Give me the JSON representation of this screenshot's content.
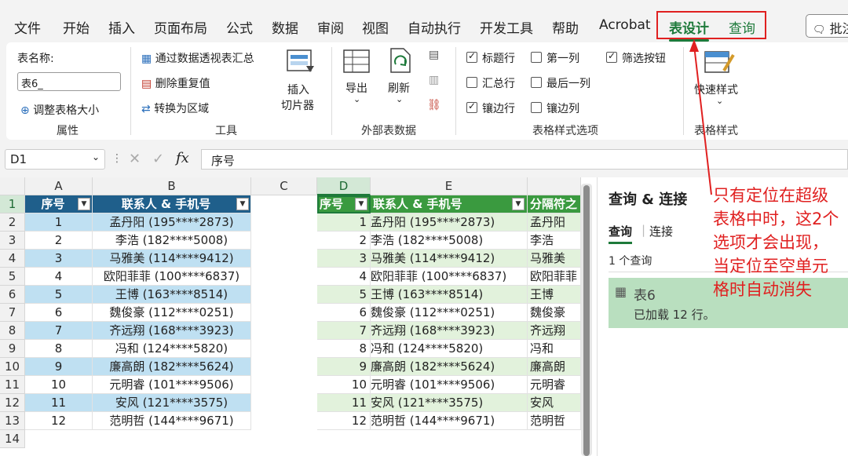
{
  "tabs": [
    "文件",
    "开始",
    "插入",
    "页面布局",
    "公式",
    "数据",
    "审阅",
    "视图",
    "自动执行",
    "开发工具",
    "帮助",
    "Acrobat"
  ],
  "tab_design": "表设计",
  "tab_query": "查询",
  "comment_button": "批注",
  "ribbon": {
    "table_name_label": "表名称:",
    "table_name_value": "表6_",
    "resize_table": "调整表格大小",
    "group_properties": "属性",
    "pivot_summary": "通过数据透视表汇总",
    "remove_duplicates": "删除重复值",
    "convert_to_range": "转换为区域",
    "insert_slicer_1": "插入",
    "insert_slicer_2": "切片器",
    "group_tools": "工具",
    "export": "导出",
    "refresh": "刷新",
    "group_external": "外部表数据",
    "opt_header_row": "标题行",
    "opt_total_row": "汇总行",
    "opt_banded_rows": "镶边行",
    "opt_first_column": "第一列",
    "opt_last_column": "最后一列",
    "opt_banded_columns": "镶边列",
    "opt_filter_button": "筛选按钮",
    "group_style_options": "表格样式选项",
    "quick_styles": "快速样式",
    "group_table_styles": "表格样式"
  },
  "formula_bar": {
    "name_box": "D1",
    "fx": "fx",
    "content": "序号"
  },
  "columns": [
    "A",
    "B",
    "C",
    "D",
    "E"
  ],
  "rows": [
    "1",
    "2",
    "3",
    "4",
    "5",
    "6",
    "7",
    "8",
    "9",
    "10",
    "11",
    "12",
    "13",
    "14"
  ],
  "table_left": {
    "headers": [
      "序号",
      "联系人 & 手机号"
    ],
    "rows": [
      [
        "1",
        "孟丹阳 (195****2873)"
      ],
      [
        "2",
        "李浩 (182****5008)"
      ],
      [
        "3",
        "马雅美 (114****9412)"
      ],
      [
        "4",
        "欧阳菲菲 (100****6837)"
      ],
      [
        "5",
        "王博 (163****8514)"
      ],
      [
        "6",
        "魏俊豪 (112****0251)"
      ],
      [
        "7",
        "齐远翔 (168****3923)"
      ],
      [
        "8",
        "冯和 (124****5820)"
      ],
      [
        "9",
        "廉高朗 (182****5624)"
      ],
      [
        "10",
        "元明睿 (101****9506)"
      ],
      [
        "11",
        "安风 (121****3575)"
      ],
      [
        "12",
        "范明哲 (144****9671)"
      ]
    ]
  },
  "table_right": {
    "headers": [
      "序号",
      "联系人 & 手机号",
      "分隔符之"
    ],
    "rows": [
      [
        "1",
        "孟丹阳 (195****2873)",
        "孟丹阳"
      ],
      [
        "2",
        "李浩 (182****5008)",
        "李浩"
      ],
      [
        "3",
        "马雅美 (114****9412)",
        "马雅美"
      ],
      [
        "4",
        "欧阳菲菲 (100****6837)",
        "欧阳菲菲"
      ],
      [
        "5",
        "王博 (163****8514)",
        "王博"
      ],
      [
        "6",
        "魏俊豪 (112****0251)",
        "魏俊豪"
      ],
      [
        "7",
        "齐远翔 (168****3923)",
        "齐远翔"
      ],
      [
        "8",
        "冯和 (124****5820)",
        "冯和"
      ],
      [
        "9",
        "廉高朗 (182****5624)",
        "廉高朗"
      ],
      [
        "10",
        "元明睿 (101****9506)",
        "元明睿"
      ],
      [
        "11",
        "安风 (121****3575)",
        "安风"
      ],
      [
        "12",
        "范明哲 (144****9671)",
        "范明哲"
      ]
    ]
  },
  "query_pane": {
    "title": "查询 & 连接",
    "tab_queries": "查询",
    "tab_connections": "连接",
    "count": "1 个查询",
    "query_name": "表6",
    "query_status": "已加载 12 行。"
  },
  "annotation": "只有定位在超级表格中时，这2个选项才会出现，当定位至空单元格时自动消失",
  "colors": {
    "accent_green": "#1e7a3b",
    "table_blue_header": "#1f5f8b",
    "table_green_header": "#3a9a3f",
    "annotation_red": "#e02020"
  }
}
